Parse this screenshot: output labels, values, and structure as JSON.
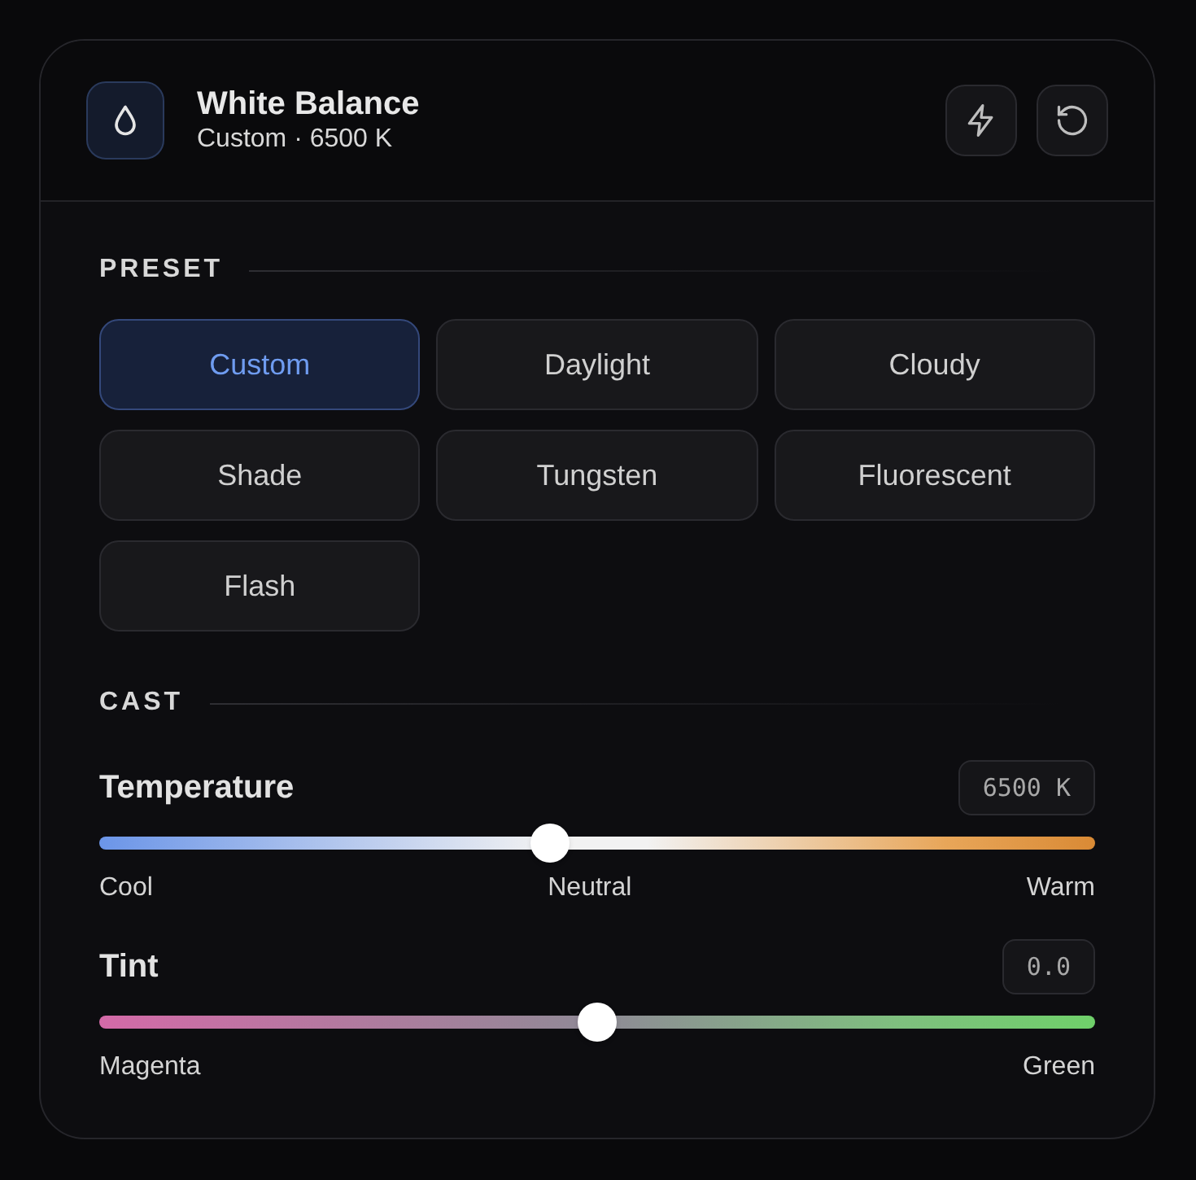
{
  "header": {
    "title": "White Balance",
    "subtitle": "Custom · 6500 K"
  },
  "preset": {
    "label": "PRESET",
    "options": [
      {
        "label": "Custom",
        "selected": true
      },
      {
        "label": "Daylight",
        "selected": false
      },
      {
        "label": "Cloudy",
        "selected": false
      },
      {
        "label": "Shade",
        "selected": false
      },
      {
        "label": "Tungsten",
        "selected": false
      },
      {
        "label": "Fluorescent",
        "selected": false
      },
      {
        "label": "Flash",
        "selected": false
      }
    ]
  },
  "cast": {
    "label": "CAST",
    "sliders": [
      {
        "kind": "temperature",
        "label": "Temperature",
        "value": "6500 K",
        "level": 0.453,
        "scale": [
          "Cool",
          "Neutral",
          "Warm"
        ]
      },
      {
        "kind": "tint",
        "label": "Tint",
        "value": "0.0",
        "level": 0.5,
        "scale": [
          "Magenta",
          "Green"
        ]
      }
    ]
  }
}
